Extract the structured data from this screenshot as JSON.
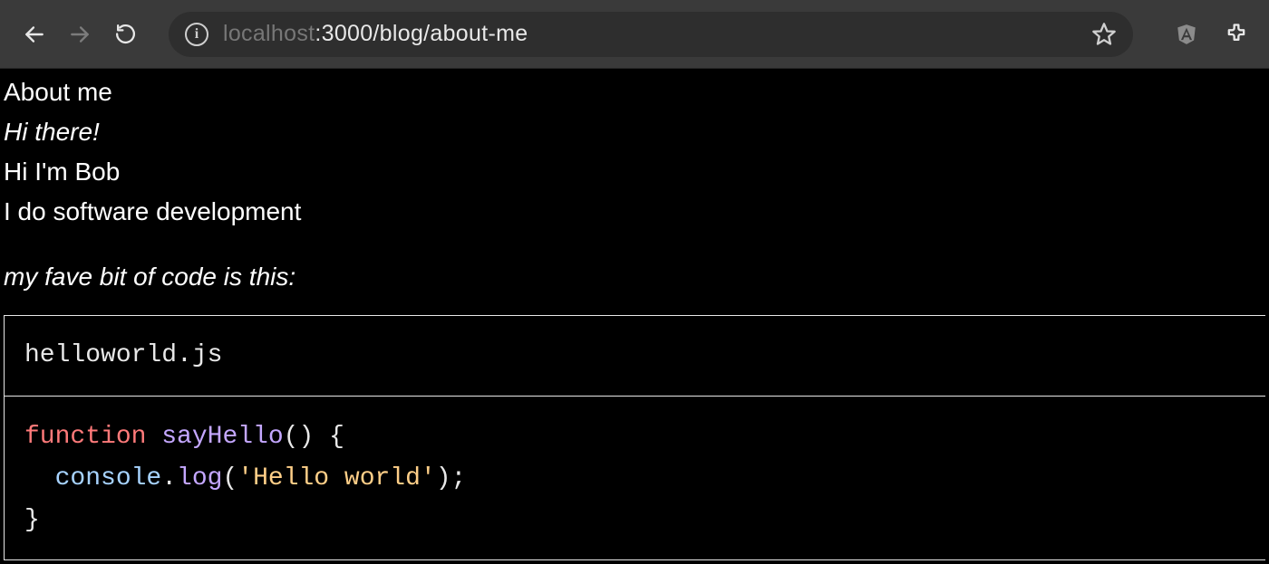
{
  "browser": {
    "url_host": "localhost",
    "url_port_path": ":3000/blog/about-me"
  },
  "content": {
    "title": "About me",
    "greeting_italic": "Hi there!",
    "intro_line": "Hi I'm Bob",
    "job_line": "I do software development",
    "code_intro_italic": "my fave bit of code is this:",
    "code_filename": "helloworld.js",
    "code": {
      "kw_function": "function",
      "fn_name": "sayHello",
      "parens_open": "()",
      "brace_open": "{",
      "indent": "  ",
      "console": "console",
      "dot": ".",
      "log": "log",
      "call_open": "(",
      "string": "'Hello world'",
      "call_close": ")",
      "semicolon": ";",
      "brace_close": "}"
    }
  }
}
